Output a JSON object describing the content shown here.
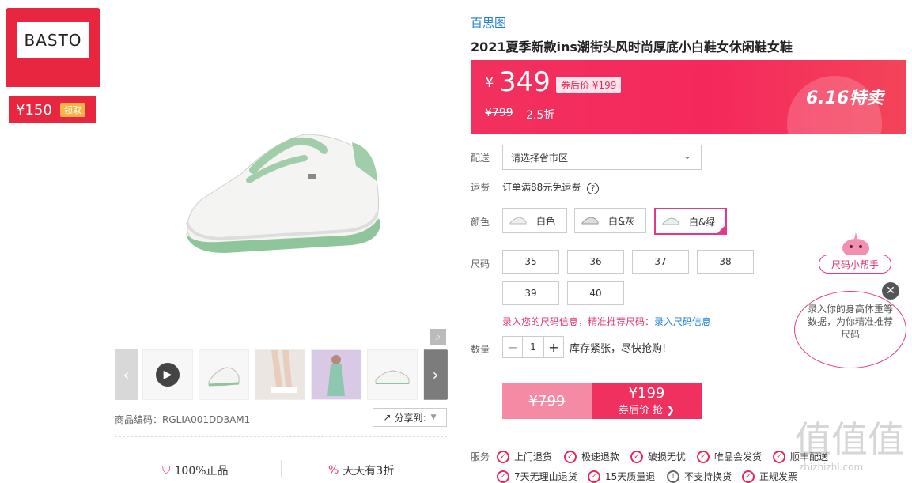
{
  "coupon": {
    "brand_logo": "BASTO",
    "price": "¥150",
    "claim_label": "领取"
  },
  "gallery": {
    "sku_code": "商品编码：RGLIA001DD3AM1",
    "share_label": "分享到:",
    "thumbnails": [
      "video-thumb",
      "shoe-side",
      "legs-photo",
      "model-photo",
      "shoe-pair"
    ]
  },
  "guarantees": [
    {
      "label": "100%正品",
      "icon": "shield-check-icon"
    },
    {
      "label": "天天有3折",
      "icon": "percent-icon"
    }
  ],
  "product": {
    "brand": "百思图",
    "title": "2021夏季新款ins潮街头风时尚厚底小白鞋女休闲鞋女鞋"
  },
  "price": {
    "currency": "¥",
    "current": "349",
    "coupon_tag": "券后价 ¥199",
    "original": "¥799",
    "discount": "2.5折",
    "promo": "6.16特卖"
  },
  "labels": {
    "delivery": "配送",
    "freight": "运费",
    "color": "颜色",
    "size": "尺码",
    "quantity": "数量",
    "service": "服务"
  },
  "delivery": {
    "placeholder": "请选择省市区"
  },
  "freight": {
    "text": "订单满88元免运费"
  },
  "colors": [
    {
      "label": "白色",
      "selected": false
    },
    {
      "label": "白&灰",
      "selected": false
    },
    {
      "label": "白&绿",
      "selected": true
    }
  ],
  "sizes": [
    "35",
    "36",
    "37",
    "38",
    "39",
    "40"
  ],
  "size_rec": {
    "text": "录入您的尺码信息，精准推荐尺码：",
    "link": "录入尺码信息"
  },
  "quantity": {
    "value": "1",
    "minus": "−",
    "plus": "+",
    "stock_msg": "库存紧张，尽快抢购!"
  },
  "buy": {
    "original": "¥799",
    "price": "¥199",
    "action": "券后价 抢 ❯"
  },
  "services": [
    "上门退货",
    "极速退款",
    "破损无忧",
    "唯品会发货",
    "顺丰配送"
  ],
  "services_row2": [
    "7天无理由退货",
    "15天质量退",
    "不支持换货",
    "正规发票"
  ],
  "helper": {
    "pill": "尺码小帮手",
    "bubble": "录入你的身高体重等数据，为你精准推荐尺码"
  },
  "watermark": {
    "glyphs": "值值值",
    "site": "zhizhizhi.com"
  }
}
